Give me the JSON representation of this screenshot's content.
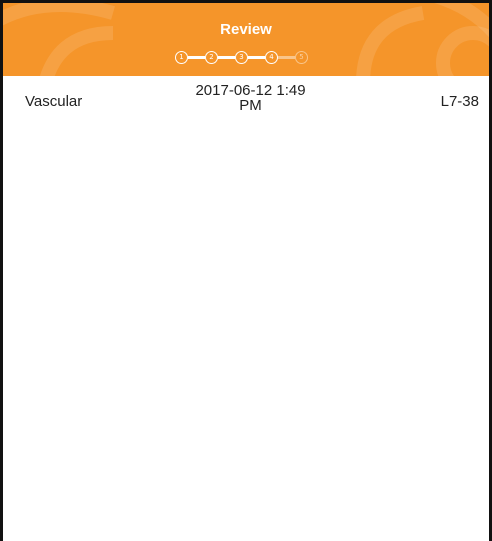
{
  "header": {
    "title": "Review",
    "accent_color": "#f5952a",
    "steps": [
      {
        "label": "1",
        "state": "completed"
      },
      {
        "label": "2",
        "state": "completed"
      },
      {
        "label": "3",
        "state": "completed"
      },
      {
        "label": "4",
        "state": "current"
      },
      {
        "label": "5",
        "state": "pending"
      }
    ]
  },
  "exam": {
    "type": "Vascular",
    "date": "2017-06-12 1:49 PM",
    "probe": "L7-38"
  }
}
